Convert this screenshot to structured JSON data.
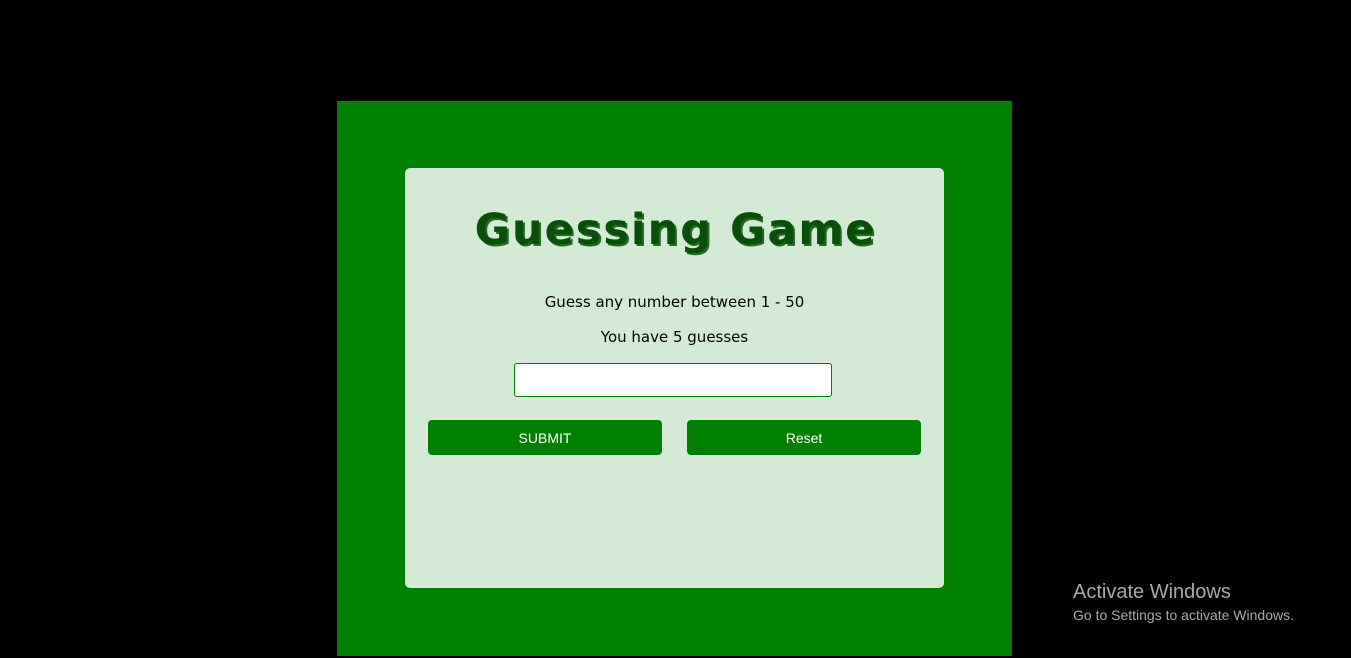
{
  "game": {
    "title": "Guessing Game",
    "instruction": "Guess any number between 1 - 50",
    "guesses_text": "You have 5 guesses",
    "input_value": "",
    "input_placeholder": "",
    "submit_label": "SUBMIT",
    "reset_label": "Reset"
  },
  "watermark": {
    "title": "Activate Windows",
    "subtitle": "Go to Settings to activate Windows."
  },
  "colors": {
    "background": "#000000",
    "frame": "#008000",
    "card": "#d4ead6",
    "title": "#0b4d0b",
    "button": "#008000",
    "button_text": "#ffffff"
  }
}
